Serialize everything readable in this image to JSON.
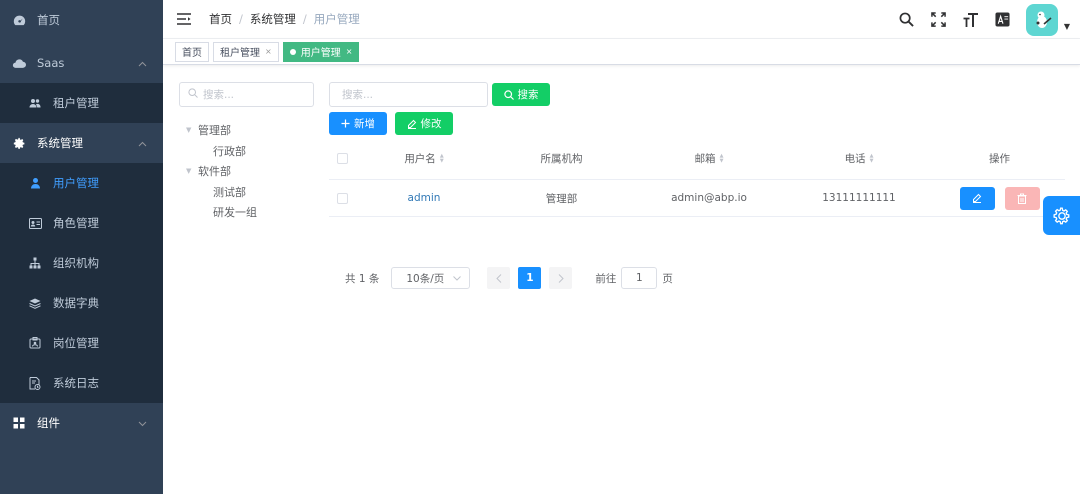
{
  "sidebar": {
    "home": "首页",
    "saas": "Saas",
    "tenant": "租户管理",
    "system": "系统管理",
    "user": "用户管理",
    "role": "角色管理",
    "org": "组织机构",
    "dict": "数据字典",
    "post": "岗位管理",
    "log": "系统日志",
    "component": "组件"
  },
  "breadcrumb": [
    "首页",
    "系统管理",
    "用户管理"
  ],
  "tags": [
    {
      "label": "首页"
    },
    {
      "label": "租户管理",
      "close": "×"
    },
    {
      "label": "用户管理",
      "close": "×"
    }
  ],
  "tree": {
    "search_placeholder": "搜索...",
    "nodes": [
      {
        "label": "管理部",
        "level": 0
      },
      {
        "label": "行政部",
        "level": 1
      },
      {
        "label": "软件部",
        "level": 0
      },
      {
        "label": "测试部",
        "level": 1
      },
      {
        "label": "研发一组",
        "level": 1
      }
    ]
  },
  "search": {
    "placeholder": "搜索...",
    "button": "搜索",
    "add": "新增",
    "edit": "修改"
  },
  "table": {
    "headers": {
      "username": "用户名",
      "org": "所属机构",
      "email": "邮箱",
      "phone": "电话",
      "op": "操作"
    },
    "rows": [
      {
        "username": "admin",
        "org": "管理部",
        "email": "admin@abp.io",
        "phone": "13111111111"
      }
    ]
  },
  "pagination": {
    "total": "共 1 条",
    "size": "10条/页",
    "current": "1",
    "goto_prefix": "前往",
    "goto_value": "1",
    "goto_suffix": "页"
  },
  "colors": {
    "sidebar_bg": "#304156",
    "submenu_bg": "#1f2d3d",
    "primary": "#1890ff",
    "success": "#13ce66",
    "tag_active": "#42b983",
    "danger_light": "#fab6b6"
  }
}
